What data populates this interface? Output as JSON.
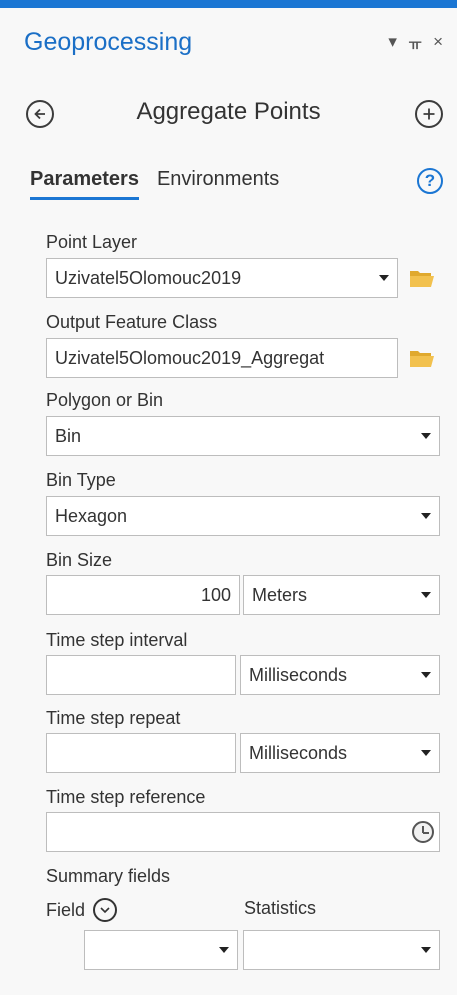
{
  "pane": {
    "title": "Geoprocessing",
    "controls": {
      "menu": "▾",
      "pin": "ᚂ",
      "close": "×"
    }
  },
  "tool": {
    "title": "Aggregate Points",
    "back_icon": "arrow-left-circle-icon",
    "add_icon": "plus-circle-icon"
  },
  "tabs": {
    "parameters": "Parameters",
    "environments": "Environments",
    "help": "?"
  },
  "params": {
    "point_layer": {
      "label": "Point Layer",
      "value": "Uzivatel5Olomouc2019"
    },
    "output_feature_class": {
      "label": "Output Feature Class",
      "value": "Uzivatel5Olomouc2019_Aggregat"
    },
    "polygon_or_bin": {
      "label": "Polygon or Bin",
      "value": "Bin"
    },
    "bin_type": {
      "label": "Bin Type",
      "value": "Hexagon"
    },
    "bin_size": {
      "label": "Bin Size",
      "value": "100",
      "unit": "Meters"
    },
    "time_step_interval": {
      "label": "Time step interval",
      "value": "",
      "unit": "Milliseconds"
    },
    "time_step_repeat": {
      "label": "Time step repeat",
      "value": "",
      "unit": "Milliseconds"
    },
    "time_step_reference": {
      "label": "Time step reference",
      "value": ""
    },
    "summary_fields": {
      "label": "Summary fields",
      "field_header": "Field",
      "statistics_header": "Statistics",
      "field_value": "",
      "statistics_value": ""
    }
  },
  "colors": {
    "accent": "#1b76d3",
    "folder": "#f2c14e"
  }
}
